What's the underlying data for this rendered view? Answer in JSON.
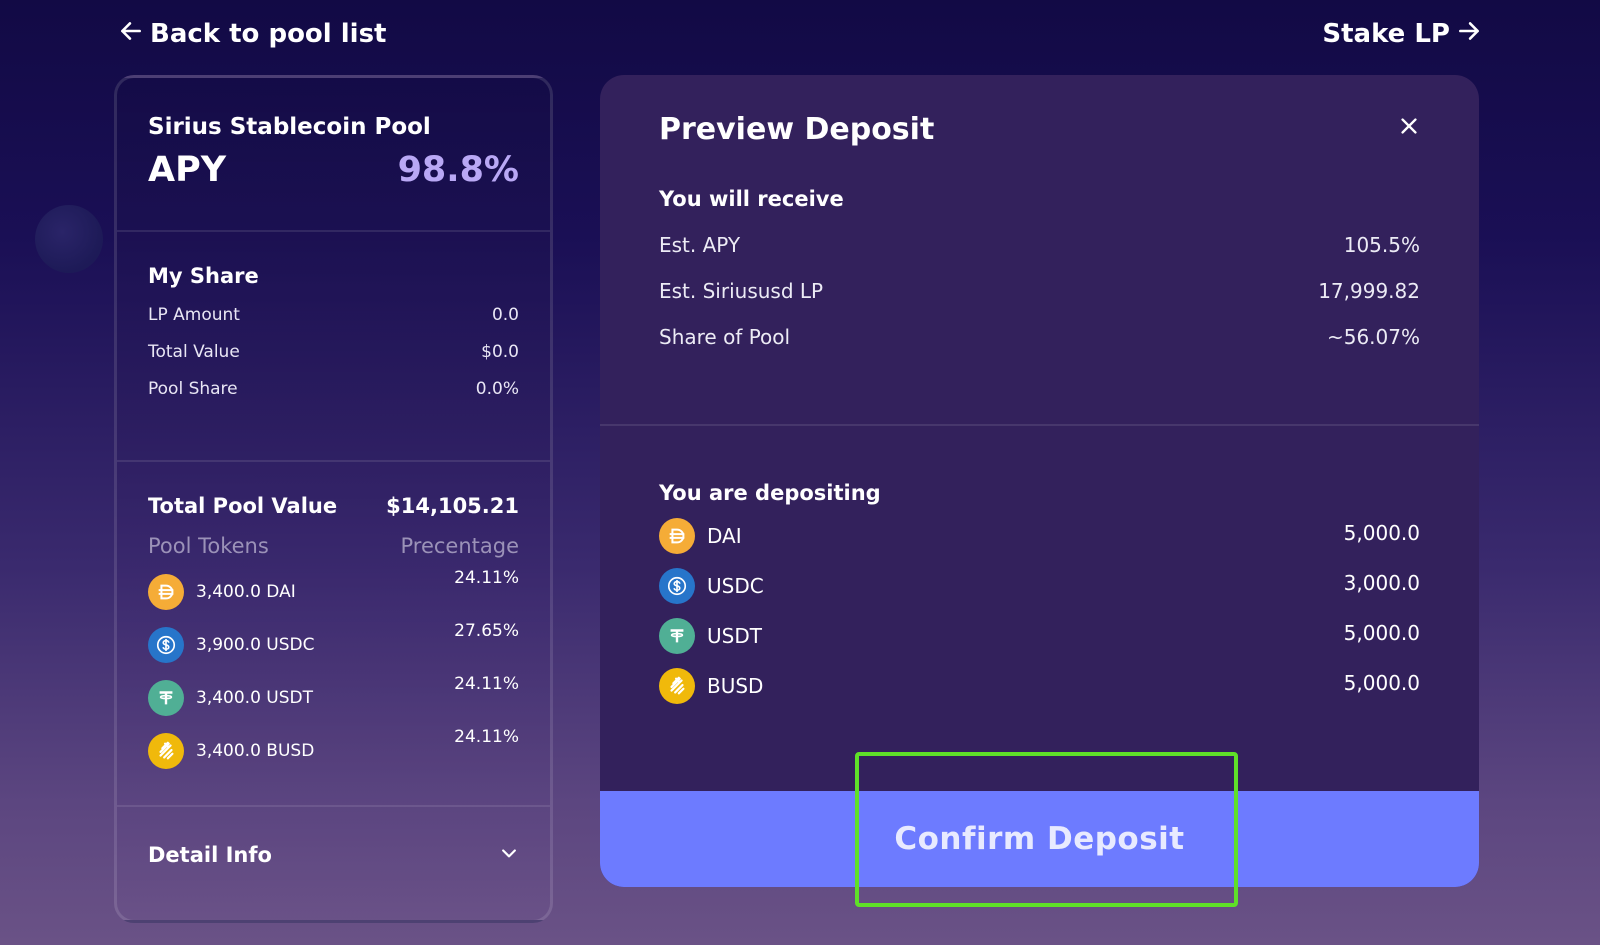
{
  "nav": {
    "back_label": "Back to pool list",
    "stake_label": "Stake LP"
  },
  "pool_card": {
    "name": "Sirius Stablecoin Pool",
    "apy_label": "APY",
    "apy_value": "98.8%",
    "my_share": {
      "title": "My Share",
      "rows": [
        {
          "label": "LP Amount",
          "value": "0.0"
        },
        {
          "label": "Total Value",
          "value": "$0.0"
        },
        {
          "label": "Pool Share",
          "value": "0.0%"
        }
      ]
    },
    "pool": {
      "title": "Total Pool Value",
      "total": "$14,105.21",
      "col_tokens": "Pool Tokens",
      "col_pct": "Precentage",
      "tokens": [
        {
          "icon": "dai-icon",
          "label": "3,400.0 DAI",
          "pct": "24.11%"
        },
        {
          "icon": "usdc-icon",
          "label": "3,900.0 USDC",
          "pct": "27.65%"
        },
        {
          "icon": "usdt-icon",
          "label": "3,400.0 USDT",
          "pct": "24.11%"
        },
        {
          "icon": "busd-icon",
          "label": "3,400.0 BUSD",
          "pct": "24.11%"
        }
      ]
    },
    "detail_label": "Detail Info"
  },
  "preview": {
    "title": "Preview Deposit",
    "receive_title": "You will receive",
    "receive": [
      {
        "label": "Est. APY",
        "value": "105.5%"
      },
      {
        "label": "Est. Siriususd LP",
        "value": "17,999.82"
      },
      {
        "label": "Share of Pool",
        "value": "~56.07%"
      }
    ],
    "deposit_title": "You are depositing",
    "deposits": [
      {
        "icon": "dai-icon",
        "symbol": "DAI",
        "amount": "5,000.0"
      },
      {
        "icon": "usdc-icon",
        "symbol": "USDC",
        "amount": "3,000.0"
      },
      {
        "icon": "usdt-icon",
        "symbol": "USDT",
        "amount": "5,000.0"
      },
      {
        "icon": "busd-icon",
        "symbol": "BUSD",
        "amount": "5,000.0"
      }
    ],
    "confirm_label": "Confirm Deposit"
  },
  "colors": {
    "accent": "#6d7bff",
    "apy": "#b9a8f5",
    "dai": "#f5ac37",
    "usdc": "#2775ca",
    "usdt": "#50af95",
    "busd": "#f0b90b",
    "highlight": "#5fe028"
  }
}
